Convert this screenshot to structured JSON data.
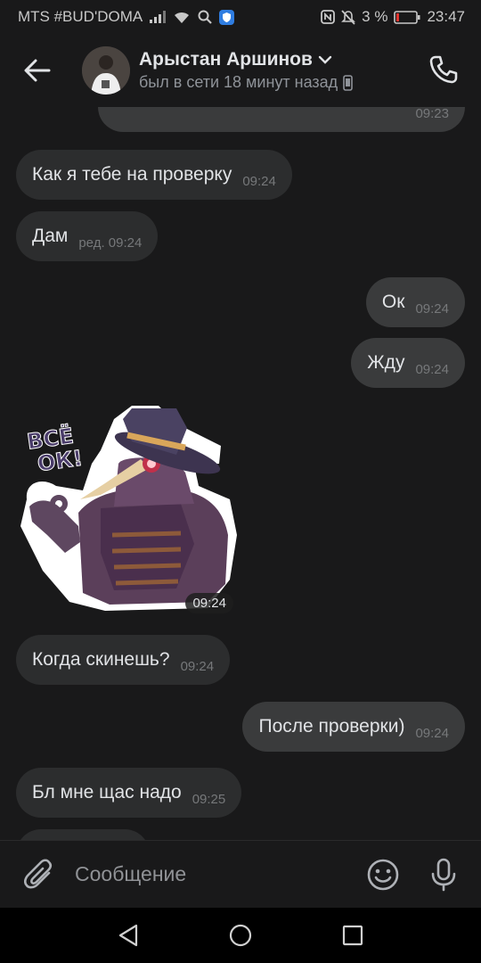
{
  "statusbar": {
    "carrier": "MTS #BUD'DOMA",
    "battery_text": "3 %",
    "clock": "23:47"
  },
  "header": {
    "name": "Арыстан Аршинов",
    "last_seen": "был в сети 18 минут назад"
  },
  "messages": [
    {
      "text": "",
      "time": "09:23",
      "dir": "out"
    },
    {
      "text": "Как я тебе на проверку",
      "time": "09:24",
      "dir": "in"
    },
    {
      "text": "Дам",
      "time": "ред. 09:24",
      "dir": "in"
    },
    {
      "text": "Ок",
      "time": "09:24",
      "dir": "out"
    },
    {
      "text": "Жду",
      "time": "09:24",
      "dir": "out"
    },
    {
      "text": "Когда скинешь?",
      "time": "09:24",
      "dir": "in"
    },
    {
      "text": "После проверки)",
      "time": "09:24",
      "dir": "out"
    },
    {
      "text": "Бл мне щас надо",
      "time": "09:25",
      "dir": "in"
    }
  ],
  "sticker": {
    "caption": "ВСЁ ОК!",
    "time": "09:24"
  },
  "composer": {
    "placeholder": "Сообщение"
  },
  "colors": {
    "background": "#19191a",
    "bubble_in": "#2c2d2e",
    "bubble_out": "#3a3b3c",
    "text": "#e1e3e6",
    "muted": "#76787a"
  }
}
